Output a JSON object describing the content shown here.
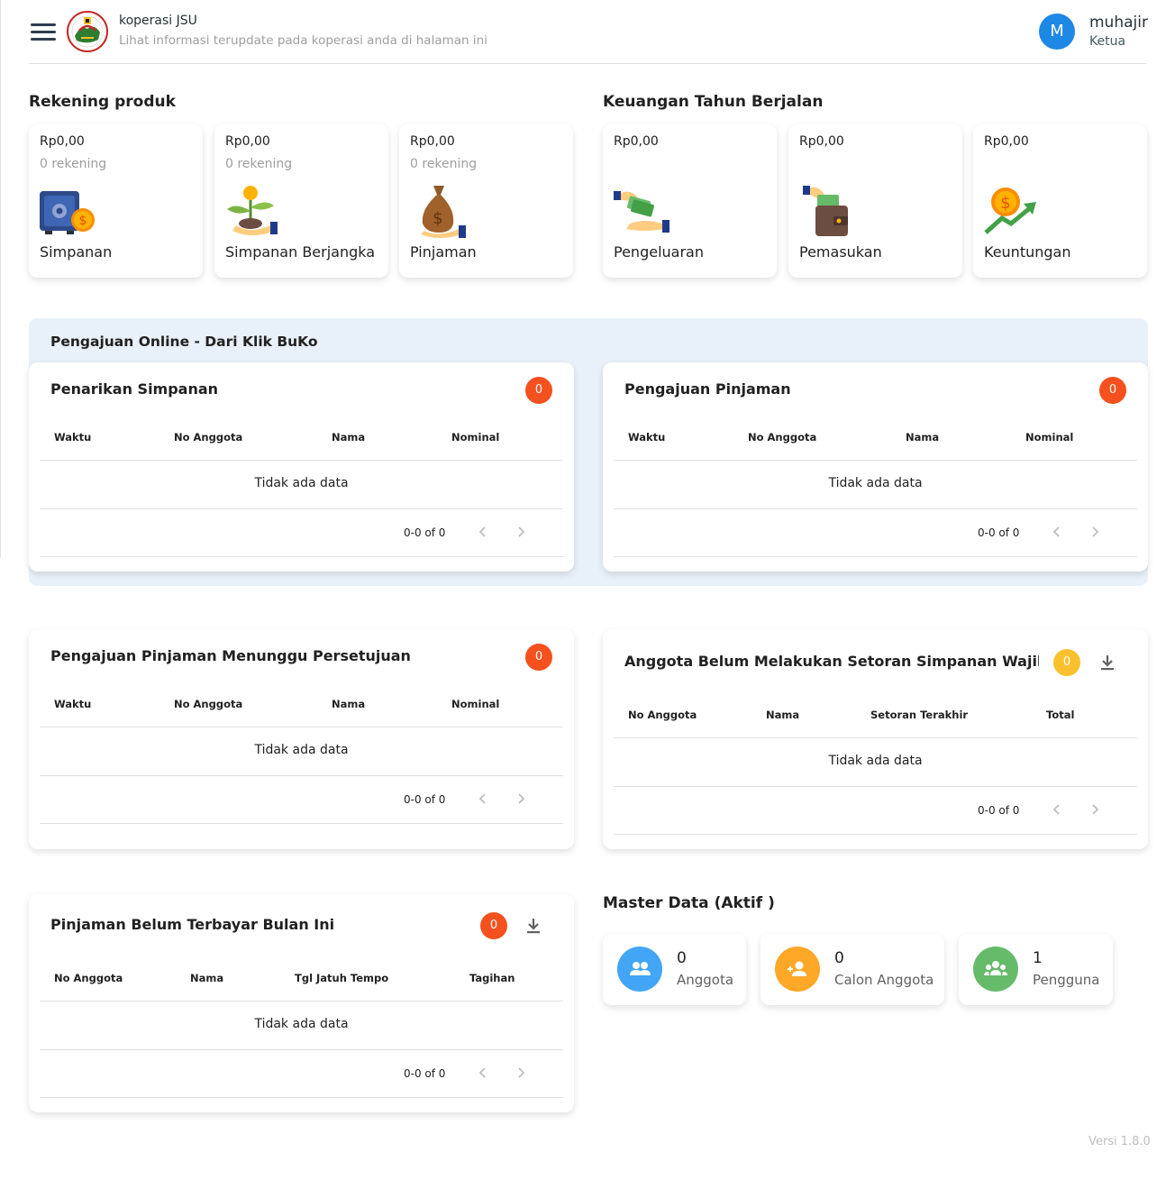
{
  "header": {
    "title": "koperasi JSU",
    "subtitle": "Lihat informasi terupdate pada koperasi anda di halaman ini",
    "user": {
      "initial": "M",
      "name": "muhajir",
      "role": "Ketua"
    }
  },
  "rekening": {
    "title": "Rekening produk",
    "cards": [
      {
        "amount": "Rp0,00",
        "count": "0 rekening",
        "label": "Simpanan",
        "icon": "safe-icon"
      },
      {
        "amount": "Rp0,00",
        "count": "0 rekening",
        "label": "Simpanan Berjangka",
        "icon": "plant-coin-icon"
      },
      {
        "amount": "Rp0,00",
        "count": "0 rekening",
        "label": "Pinjaman",
        "icon": "money-bag-icon"
      }
    ]
  },
  "keuangan": {
    "title": "Keuangan Tahun Berjalan",
    "cards": [
      {
        "amount": "Rp0,00",
        "label": "Pengeluaran",
        "icon": "hand-cash-icon"
      },
      {
        "amount": "Rp0,00",
        "label": "Pemasukan",
        "icon": "wallet-icon"
      },
      {
        "amount": "Rp0,00",
        "label": "Keuntungan",
        "icon": "coin-trend-icon"
      }
    ]
  },
  "online": {
    "title": "Pengajuan Online - Dari Klik BuKo",
    "penarikan": {
      "title": "Penarikan Simpanan",
      "badge": "0",
      "columns": [
        "Waktu",
        "No Anggota",
        "Nama",
        "Nominal"
      ],
      "empty": "Tidak ada data",
      "pager": "0-0 of 0"
    },
    "pinjaman": {
      "title": "Pengajuan Pinjaman",
      "badge": "0",
      "columns": [
        "Waktu",
        "No Anggota",
        "Nama",
        "Nominal"
      ],
      "empty": "Tidak ada data",
      "pager": "0-0 of 0"
    }
  },
  "menunggu": {
    "title": "Pengajuan Pinjaman Menunggu Persetujuan",
    "badge": "0",
    "columns": [
      "Waktu",
      "No Anggota",
      "Nama",
      "Nominal"
    ],
    "empty": "Tidak ada data",
    "pager": "0-0 of 0"
  },
  "belum_setor": {
    "title": "Anggota Belum Melakukan Setoran Simpanan Wajib B...",
    "badge": "0",
    "columns": [
      "No Anggota",
      "Nama",
      "Setoran Terakhir",
      "Total"
    ],
    "empty": "Tidak ada data",
    "pager": "0-0 of 0"
  },
  "belum_bayar": {
    "title": "Pinjaman Belum Terbayar Bulan Ini",
    "badge": "0",
    "columns": [
      "No Anggota",
      "Nama",
      "Tgl Jatuh Tempo",
      "Tagihan"
    ],
    "empty": "Tidak ada data",
    "pager": "0-0 of 0"
  },
  "master": {
    "title": "Master Data (Aktif )",
    "items": [
      {
        "value": "0",
        "label": "Anggota",
        "color": "#42a5f5",
        "icon": "group-icon"
      },
      {
        "value": "0",
        "label": "Calon Anggota",
        "color": "#ffa726",
        "icon": "person-add-icon"
      },
      {
        "value": "1",
        "label": "Pengguna",
        "color": "#66bb6a",
        "icon": "users-icon"
      }
    ]
  },
  "version": "Versi 1.8.0",
  "colors": {
    "badge_red": "#f4511e",
    "badge_yellow": "#fbc02d",
    "avatar": "#1e88e5",
    "online_bg": "#e8f0f9"
  }
}
